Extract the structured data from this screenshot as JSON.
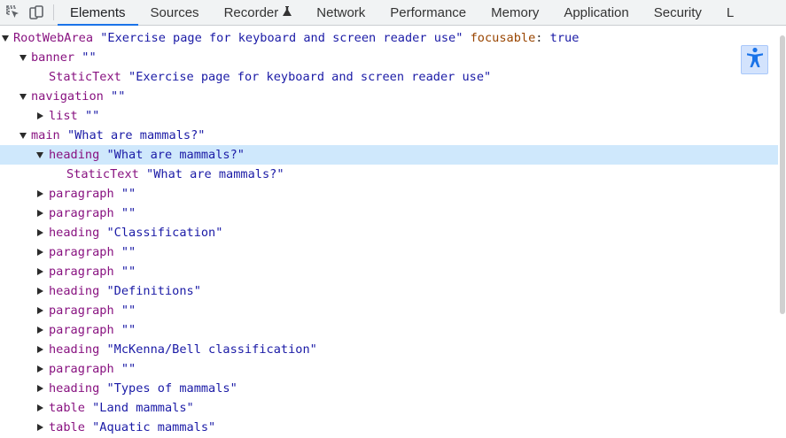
{
  "toolbar": {
    "tabs": [
      {
        "label": "Elements",
        "active": true
      },
      {
        "label": "Sources"
      },
      {
        "label": "Recorder"
      },
      {
        "label": "Network"
      },
      {
        "label": "Performance"
      },
      {
        "label": "Memory"
      },
      {
        "label": "Application"
      },
      {
        "label": "Security"
      },
      {
        "label": "L"
      }
    ],
    "icons": [
      "inspect-element-icon",
      "device-toolbar-icon",
      "flask-icon"
    ]
  },
  "tree": {
    "rows": [
      {
        "role": "RootWebArea",
        "name": "\"Exercise page for keyboard and screen reader use\"",
        "attr": "focusable",
        "colon": ":",
        "value": "true"
      },
      {
        "role": "banner",
        "name": "\"\""
      },
      {
        "role": "StaticText",
        "name": "\"Exercise page for keyboard and screen reader use\""
      },
      {
        "role": "navigation",
        "name": "\"\""
      },
      {
        "role": "list",
        "name": "\"\""
      },
      {
        "role": "main",
        "name": "\"What are mammals?\""
      },
      {
        "role": "heading",
        "name": "\"What are mammals?\""
      },
      {
        "role": "StaticText",
        "name": "\"What are mammals?\""
      },
      {
        "role": "paragraph",
        "name": "\"\""
      },
      {
        "role": "paragraph",
        "name": "\"\""
      },
      {
        "role": "heading",
        "name": "\"Classification\""
      },
      {
        "role": "paragraph",
        "name": "\"\""
      },
      {
        "role": "paragraph",
        "name": "\"\""
      },
      {
        "role": "heading",
        "name": "\"Definitions\""
      },
      {
        "role": "paragraph",
        "name": "\"\""
      },
      {
        "role": "paragraph",
        "name": "\"\""
      },
      {
        "role": "heading",
        "name": "\"McKenna/Bell classification\""
      },
      {
        "role": "paragraph",
        "name": "\"\""
      },
      {
        "role": "heading",
        "name": "\"Types of mammals\""
      },
      {
        "role": "table",
        "name": "\"Land mammals\""
      },
      {
        "role": "table",
        "name": "\"Aquatic mammals\""
      }
    ]
  },
  "accessibility_button": {
    "icon": "accessibility-person-icon",
    "color": "#1a73e8"
  },
  "colors": {
    "selected_row": "#cfe8fc",
    "role": "#881280",
    "name": "#1a1aa6",
    "attr": "#994500",
    "accent": "#1a73e8"
  }
}
